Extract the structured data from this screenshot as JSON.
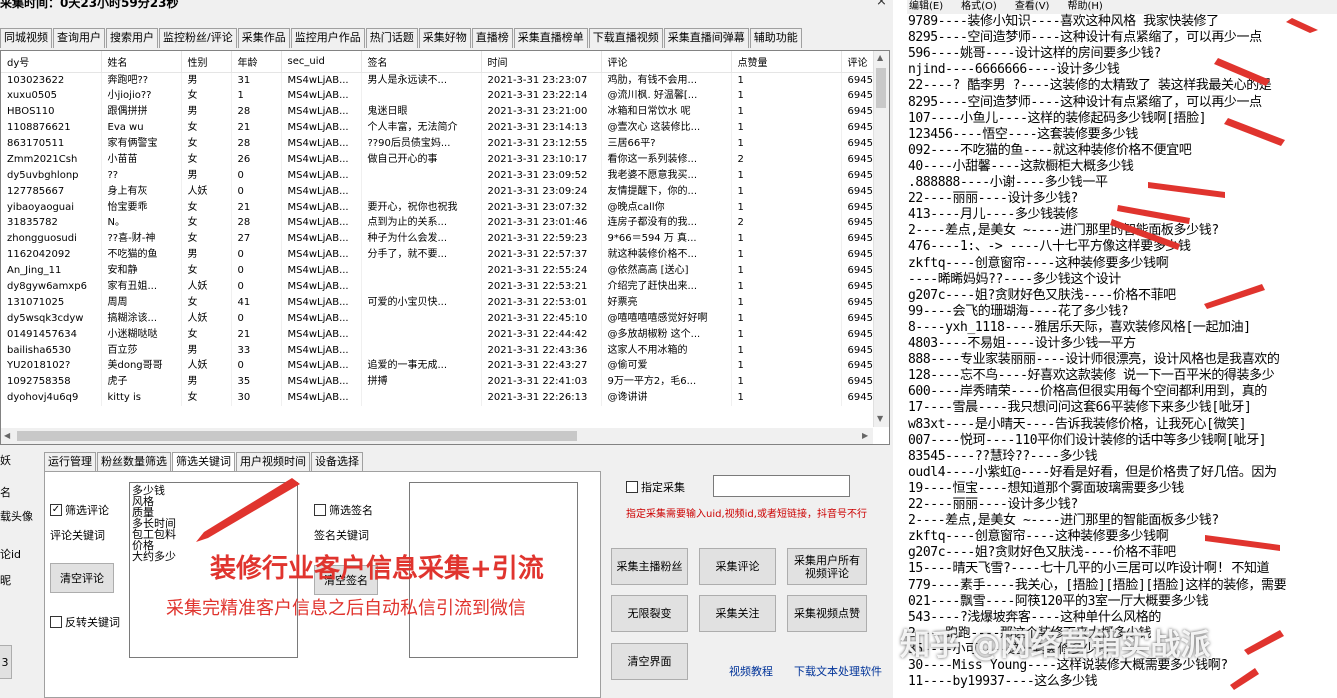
{
  "window": {
    "title": "采集时间：0天23小时59分23秒",
    "close": "×"
  },
  "top_tabs": [
    "同城视频",
    "查询用户",
    "搜索用户",
    "监控粉丝/评论",
    "采集作品",
    "监控用户作品",
    "热门话题",
    "采集好物",
    "直播榜",
    "采集直播榜单",
    "下载直播视频",
    "采集直播间弹幕",
    "辅助功能"
  ],
  "grid": {
    "columns": [
      "dy号",
      "姓名",
      "性别",
      "年龄",
      "sec_uid",
      "签名",
      "时间",
      "评论",
      "点赞量",
      "评论"
    ],
    "rows": [
      [
        "103023622",
        "奔跑吧??",
        "男",
        "31",
        "MS4wLjAB...",
        "男人是永远读不...",
        "2021-3-31 23:23:07",
        "鸡肋，有钱不会用...",
        "1",
        "6945"
      ],
      [
        "xuxu0505",
        "小jiojio??",
        "女",
        "1",
        "MS4wLjAB...",
        "",
        "2021-3-31 23:22:14",
        "@流川枫. 好温馨[...",
        "1",
        "6945"
      ],
      [
        "HBOS110",
        "跟偶拼拼",
        "男",
        "28",
        "MS4wLjAB...",
        "鬼迷日眼",
        "2021-3-31 23:21:00",
        "冰箱和日常饮水 呢",
        "1",
        "6945"
      ],
      [
        "1108876621",
        "Eva wu",
        "女",
        "21",
        "MS4wLjAB...",
        "个人丰富，无法简介",
        "2021-3-31 23:14:13",
        "@壹次心 这装修比...",
        "1",
        "6945"
      ],
      [
        "863170511",
        "家有俩警宝",
        "女",
        "28",
        "MS4wLjAB...",
        "??90后员债宝妈...",
        "2021-3-31 23:12:55",
        "三居66平?",
        "1",
        "6945"
      ],
      [
        "Zmm2021Csh",
        "小苗苗",
        "女",
        "26",
        "MS4wLjAB...",
        "做自己开心的事",
        "2021-3-31 23:10:17",
        "看你这一系列装修...",
        "2",
        "6945"
      ],
      [
        "dy5uvbghlonp",
        "??",
        "男",
        "0",
        "MS4wLjAB...",
        "",
        "2021-3-31 23:09:52",
        "我老婆不愿意我买...",
        "1",
        "6945"
      ],
      [
        "127785667",
        "身上有灰",
        "人妖",
        "0",
        "MS4wLjAB...",
        "",
        "2021-3-31 23:09:24",
        "友情提醒下，你的...",
        "1",
        "6945"
      ],
      [
        "yibaoyaoguai",
        "怡宝要乖",
        "女",
        "21",
        "MS4wLjAB...",
        "要开心，祝你也祝我",
        "2021-3-31 23:07:32",
        "@晚点call你",
        "1",
        "6945"
      ],
      [
        "31835782",
        "N。",
        "女",
        "28",
        "MS4wLjAB...",
        "点到为止的关系...",
        "2021-3-31 23:01:46",
        "连房子都没有的我...",
        "2",
        "6945"
      ],
      [
        "zhongguosudi",
        "??喜-财-神",
        "女",
        "27",
        "MS4wLjAB...",
        "种子为什么会发...",
        "2021-3-31 22:59:23",
        "9*66＝594 万 真...",
        "1",
        "6945"
      ],
      [
        "1162042092",
        "不吃猫的鱼",
        "男",
        "0",
        "MS4wLjAB...",
        "分手了，就不要...",
        "2021-3-31 22:57:37",
        "就这种装修价格不...",
        "1",
        "6945"
      ],
      [
        "An_Jing_11",
        "安和静",
        "女",
        "0",
        "MS4wLjAB...",
        "",
        "2021-3-31 22:55:24",
        "@依然高高 [送心]",
        "1",
        "6945"
      ],
      [
        "dy8gyw6amxp6",
        "家有丑姐...",
        "人妖",
        "0",
        "MS4wLjAB...",
        "",
        "2021-3-31 22:53:21",
        "介绍完了赶快出来...",
        "1",
        "6945"
      ],
      [
        "131071025",
        "周周",
        "女",
        "41",
        "MS4wLjAB...",
        "可爱的小宝贝快...",
        "2021-3-31 22:53:01",
        "好票亮",
        "1",
        "6945"
      ],
      [
        "dy5wsqk3cdyw",
        "搞糊涂该...",
        "人妖",
        "0",
        "MS4wLjAB...",
        "",
        "2021-3-31 22:45:10",
        "@嘻嘻嘻嘻感觉好好啊",
        "1",
        "6945"
      ],
      [
        "01491457634",
        "小迷糊哒哒",
        "女",
        "21",
        "MS4wLjAB...",
        "",
        "2021-3-31 22:44:42",
        "@多放胡椒粉 这个...",
        "1",
        "6945"
      ],
      [
        "bailisha6530",
        "百立莎",
        "男",
        "33",
        "MS4wLjAB...",
        "",
        "2021-3-31 22:43:36",
        "这家人不用冰箱的",
        "1",
        "6945"
      ],
      [
        "YU2018102?",
        "美dong哥哥",
        "人妖",
        "0",
        "MS4wLjAB...",
        "追爱的一事无成...",
        "2021-3-31 22:43:27",
        "@偷可爱",
        "1",
        "6945"
      ],
      [
        "1092758358",
        "虎子",
        "男",
        "35",
        "MS4wLjAB...",
        "拼搏",
        "2021-3-31 22:41:03",
        "9万一平方2，毛6...",
        "1",
        "6945"
      ],
      [
        "dyohovj4u6q9",
        "kitty is",
        "女",
        "30",
        "MS4wLjAB...",
        "",
        "2021-3-31 22:26:13",
        "@谗讲讲",
        "1",
        "6945"
      ]
    ]
  },
  "left_labels": [
    "妖",
    "名",
    "载头像",
    "论id",
    "昵",
    "3"
  ],
  "bottom_tabs": [
    "运行管理",
    "粉丝数量筛选",
    "筛选关键词",
    "用户视频时间",
    "设备选择"
  ],
  "filter": {
    "comment_filter_label": "筛选评论",
    "comment_keyword_label": "评论关键词",
    "keywords": [
      "多少钱",
      "风格",
      "质量",
      "多长时间",
      "包工包料",
      "价格",
      "大约多少"
    ],
    "clear_comments": "清空评论",
    "reverse_keyword": "反转关键词",
    "sign_filter_label": "筛选签名",
    "sign_keyword_label": "签名关键词",
    "clear_sign": "清空签名"
  },
  "right_panel": {
    "specify_collect": "指定采集",
    "specify_value": "",
    "note": "指定采集需要输入uid,视频id,或者短链接，抖音号不行",
    "buttons": [
      "采集主播粉丝",
      "采集评论",
      "采集用户所有视频评论",
      "无限裂变",
      "采集关注",
      "采集视频点赞",
      "清空界面"
    ],
    "link_tutorial": "视频教程",
    "link_download": "下载文本处理软件"
  },
  "overlay": {
    "headline": "装修行业客户信息采集+引流",
    "sub": "采集完精准客户信息之后自动私信引流到微信"
  },
  "notepad": {
    "menu": [
      "编辑(E)",
      "格式(O)",
      "查看(V)",
      "帮助(H)"
    ],
    "lines": [
      "9789----装修小知识----喜欢这种风格 我家快装修了",
      "8295----空间造梦师----这种设计有点紧缩了，可以再少一点",
      "596----姚哥----设计这样的房间要多少钱?",
      "njind----6666666----设计多少钱",
      "22----? 酷李男 ?----这装修的太精致了 装这样我最关心的是",
      "8295----空间造梦师----这种设计有点紧缩了，可以再少一点",
      "107----小鱼儿----这样的装修起码多少钱啊[捂脸]",
      "123456----悟空----这套装修要多少钱",
      "092----不吃猫的鱼----就这种装修价格不便宜吧",
      "40----小甜馨----这款橱柜大概多少钱",
      ".888888----小谢----多少钱一平",
      "22----丽丽----设计多少钱?",
      "413----月儿----多少钱装修",
      "2----差点,是美女 ~----进门那里的智能面板多少钱?",
      "476----1:、-> ----八十七平方像这样要多少钱",
      "zkftq----创意窗帘----这种装修要多少钱啊",
      "----晞晞妈妈??----多少钱这个设计",
      "g207c----姐?贪财好色又肤浅----价格不菲吧",
      "99----会飞的珊瑚海----花了多少钱?",
      "8----yxh_1118----雅居乐天际，喜欢装修风格[一起加油]",
      "4803----不易姐----设计多少钱一平方",
      "888----专业家装丽丽----设计师很漂亮，设计风格也是我喜欢的",
      "128----忘不鸟----好喜欢这款装修 说一下一百平米的得装多少",
      "600----岸秀晴荣----价格高但很实用每个空间都利用到，真的",
      "17----雪晨----我只想问问这套66平装修下来多少钱[呲牙]",
      "w83xt----是小晴天----告诉我装修价格，让我死心[微笑]",
      "007----悦珂----110平你们设计装修的话中等多少钱啊[呲牙]",
      "83545----??慧玲??----多少钱",
      "oudl4----小紫虹@----好看是好看，但是价格贵了好几倍。因为",
      "19----恒宝----想知道那个雾面玻璃需要多少钱",
      "22----丽丽----设计多少钱?",
      "2----差点,是美女 ~----进门那里的智能面板多少钱?",
      "zkftq----创意窗帘----这种装修要多少钱啊",
      "g207c----姐?贪财好色又肤浅----价格不菲吧",
      "15----晴天飞雪?----七十几平的小三居可以咋设计啊! 不知道",
      "779----素手----我关心，[捂脸][捂脸][捂脸]这样的装修，需要",
      "021----飘雪----阿筷120平的3室一厅大概要多少钱",
      "543----?浅爆坡奔客----这种单什么风格的",
      "2----跑跑----那这个装修下来大概多少钱",
      "35----小可----这一套装修多少钱",
      "30----Miss Young----这样说装修大概需要多少钱啊?",
      "11----by19937----这么多少钱"
    ],
    "watermark": "知乎 @网络营销实战派"
  }
}
